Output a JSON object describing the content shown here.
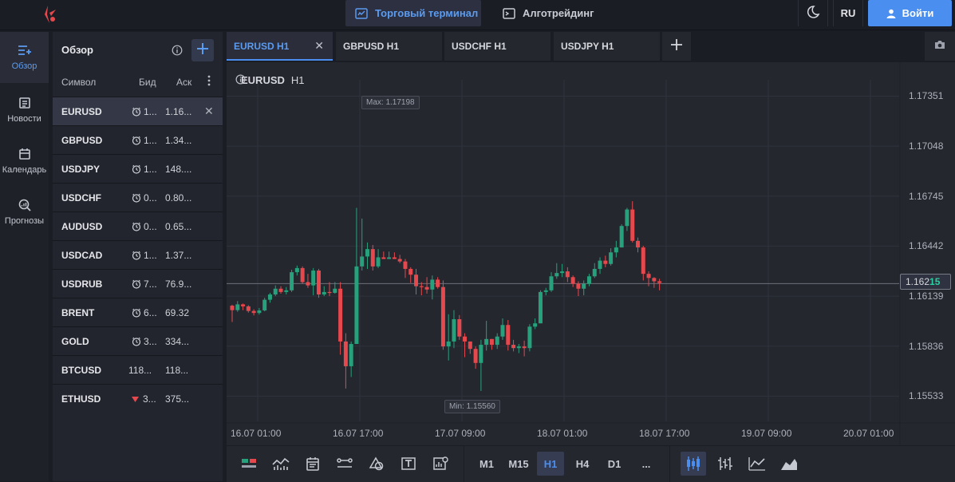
{
  "header": {
    "nav_terminal": "Торговый терминал",
    "nav_algo": "Алготрейдинг",
    "lang": "RU",
    "login": "Войти",
    "accent": "#4a8ef0"
  },
  "sidebar": {
    "items": [
      {
        "label": "Обзор",
        "icon": "watchlist-icon"
      },
      {
        "label": "Новости",
        "icon": "news-icon"
      },
      {
        "label": "Календарь",
        "icon": "calendar-icon"
      },
      {
        "label": "Прогнозы",
        "icon": "forecast-icon"
      }
    ]
  },
  "watchlist": {
    "title": "Обзор",
    "columns": {
      "symbol": "Символ",
      "bid": "Бид",
      "ask": "Аск"
    },
    "rows": [
      {
        "symbol": "EURUSD",
        "bid": "1...",
        "ask": "1.16...",
        "icon": "clock-icon"
      },
      {
        "symbol": "GBPUSD",
        "bid": "1...",
        "ask": "1.34...",
        "icon": "clock-icon"
      },
      {
        "symbol": "USDJPY",
        "bid": "1...",
        "ask": "148....",
        "icon": "clock-icon"
      },
      {
        "symbol": "USDCHF",
        "bid": "0...",
        "ask": "0.80...",
        "icon": "clock-icon"
      },
      {
        "symbol": "AUDUSD",
        "bid": "0...",
        "ask": "0.65...",
        "icon": "clock-icon"
      },
      {
        "symbol": "USDCAD",
        "bid": "1...",
        "ask": "1.37...",
        "icon": "clock-icon"
      },
      {
        "symbol": "USDRUB",
        "bid": "7...",
        "ask": "76.9...",
        "icon": "clock-icon"
      },
      {
        "symbol": "BRENT",
        "bid": "6...",
        "ask": "69.32",
        "icon": "clock-icon"
      },
      {
        "symbol": "GOLD",
        "bid": "3...",
        "ask": "334...",
        "icon": "clock-icon"
      },
      {
        "symbol": "BTCUSD",
        "bid": "118...",
        "ask": "118...",
        "icon": ""
      },
      {
        "symbol": "ETHUSD",
        "bid": "3...",
        "ask": "375...",
        "icon": "down-triangle-icon"
      }
    ]
  },
  "tabs": [
    {
      "label": "EURUSD H1"
    },
    {
      "label": "GBPUSD H1"
    },
    {
      "label": "USDCHF H1"
    },
    {
      "label": "USDJPY H1"
    }
  ],
  "chart": {
    "symbol": "EURUSD",
    "timeframe": "H1",
    "max_label": "Max: 1.17198",
    "min_label": "Min: 1.15560",
    "price_tag_main": "1.162",
    "price_tag_hl": "15",
    "up_color": "#26a17b",
    "down_color": "#e5484d"
  },
  "toolbar": {
    "timeframes": [
      "M1",
      "M15",
      "H1",
      "H4",
      "D1",
      "..."
    ],
    "active_timeframe": "H1"
  },
  "chart_data": {
    "type": "candlestick",
    "yticks": [
      "1.17351",
      "1.17048",
      "1.16745",
      "1.16442",
      "1.16139",
      "1.15836",
      "1.15533"
    ],
    "xticks": [
      "16.07 01:00",
      "16.07 17:00",
      "17.07 09:00",
      "18.07 01:00",
      "18.07 17:00",
      "19.07 09:00",
      "20.07 01:00"
    ],
    "current_price": 1.16215,
    "max": 1.17198,
    "min": 1.1556,
    "ylim": [
      1.1538,
      1.1745
    ],
    "candles": [
      [
        1.16081,
        1.16054,
        1.16087,
        1.15982
      ],
      [
        1.16054,
        1.16089,
        1.16109,
        1.16044
      ],
      [
        1.16089,
        1.16077,
        1.16094,
        1.16054
      ],
      [
        1.16077,
        1.16049,
        1.16084,
        1.16039
      ],
      [
        1.16049,
        1.16037,
        1.16059,
        1.16022
      ],
      [
        1.16037,
        1.16052,
        1.16067,
        1.16027
      ],
      [
        1.16052,
        1.16117,
        1.16129,
        1.16047
      ],
      [
        1.16117,
        1.16149,
        1.16159,
        1.16099
      ],
      [
        1.16149,
        1.16184,
        1.16204,
        1.16139
      ],
      [
        1.16184,
        1.16164,
        1.16199,
        1.16154
      ],
      [
        1.16164,
        1.16174,
        1.16194,
        1.16149
      ],
      [
        1.16174,
        1.16284,
        1.16299,
        1.16164
      ],
      [
        1.16284,
        1.16309,
        1.16324,
        1.16264
      ],
      [
        1.16309,
        1.16224,
        1.16319,
        1.16214
      ],
      [
        1.16224,
        1.16204,
        1.16274,
        1.16189
      ],
      [
        1.16204,
        1.16294,
        1.16309,
        1.16144
      ],
      [
        1.16294,
        1.16149,
        1.16304,
        1.16129
      ],
      [
        1.16149,
        1.16164,
        1.16199,
        1.16139
      ],
      [
        1.16164,
        1.16159,
        1.16224,
        1.16139
      ],
      [
        1.16159,
        1.16184,
        1.16224,
        1.16154
      ],
      [
        1.16184,
        1.15864,
        1.16224,
        1.15784
      ],
      [
        1.15864,
        1.15714,
        1.15914,
        1.15579
      ],
      [
        1.15714,
        1.15849,
        1.15864,
        1.15649
      ],
      [
        1.15849,
        1.16319,
        1.16674,
        1.15869
      ],
      [
        1.16319,
        1.16379,
        1.16609,
        1.16294
      ],
      [
        1.16379,
        1.16424,
        1.16464,
        1.16304
      ],
      [
        1.16424,
        1.16319,
        1.16449,
        1.16294
      ],
      [
        1.16319,
        1.16374,
        1.16424,
        1.16309
      ],
      [
        1.16374,
        1.16364,
        1.16409,
        1.16364
      ],
      [
        1.16364,
        1.16374,
        1.16409,
        1.16364
      ],
      [
        1.16374,
        1.16364,
        1.16404,
        1.16364
      ],
      [
        1.16364,
        1.16349,
        1.16389,
        1.16339
      ],
      [
        1.16349,
        1.16304,
        1.16364,
        1.16249
      ],
      [
        1.16304,
        1.16269,
        1.16314,
        1.16219
      ],
      [
        1.16269,
        1.16199,
        1.16304,
        1.16149
      ],
      [
        1.16199,
        1.16194,
        1.16224,
        1.16144
      ],
      [
        1.16194,
        1.16179,
        1.16254,
        1.16154
      ],
      [
        1.16179,
        1.16239,
        1.16264,
        1.16119
      ],
      [
        1.16239,
        1.16194,
        1.16254,
        1.16184
      ],
      [
        1.16194,
        1.15834,
        1.16234,
        1.15814
      ],
      [
        1.15834,
        1.15864,
        1.16029,
        1.15749
      ],
      [
        1.15864,
        1.15999,
        1.16054,
        1.15824
      ],
      [
        1.15999,
        1.15894,
        1.16024,
        1.15874
      ],
      [
        1.15894,
        1.15864,
        1.15914,
        1.15769
      ],
      [
        1.15864,
        1.15819,
        1.15864,
        1.15789
      ],
      [
        1.15819,
        1.15734,
        1.15834,
        1.15699
      ],
      [
        1.15734,
        1.15844,
        1.15874,
        1.15564
      ],
      [
        1.15844,
        1.15879,
        1.15989,
        1.15809
      ],
      [
        1.15879,
        1.15844,
        1.15879,
        1.15814
      ],
      [
        1.15844,
        1.15894,
        1.15914,
        1.15819
      ],
      [
        1.15894,
        1.15964,
        1.16004,
        1.15874
      ],
      [
        1.15964,
        1.15844,
        1.15994,
        1.15809
      ],
      [
        1.15844,
        1.15824,
        1.15874,
        1.15804
      ],
      [
        1.15824,
        1.15834,
        1.15849,
        1.15794
      ],
      [
        1.15834,
        1.15824,
        1.15869,
        1.15774
      ],
      [
        1.15824,
        1.15954,
        1.15969,
        1.15804
      ],
      [
        1.15954,
        1.15974,
        1.16004,
        1.15939
      ],
      [
        1.15974,
        1.16164,
        1.16174,
        1.15974
      ],
      [
        1.16164,
        1.16174,
        1.16189,
        1.16144
      ],
      [
        1.16174,
        1.16259,
        1.16284,
        1.16164
      ],
      [
        1.16259,
        1.16279,
        1.16339,
        1.16244
      ],
      [
        1.16279,
        1.16289,
        1.16334,
        1.16254
      ],
      [
        1.16289,
        1.16254,
        1.16314,
        1.16224
      ],
      [
        1.16254,
        1.16214,
        1.16264,
        1.16194
      ],
      [
        1.16214,
        1.16184,
        1.16229,
        1.16139
      ],
      [
        1.16184,
        1.16214,
        1.16234,
        1.16144
      ],
      [
        1.16214,
        1.16259,
        1.16274,
        1.16199
      ],
      [
        1.16259,
        1.16304,
        1.16339,
        1.16249
      ],
      [
        1.16304,
        1.16354,
        1.16374,
        1.16274
      ],
      [
        1.16354,
        1.16334,
        1.16384,
        1.16314
      ],
      [
        1.16334,
        1.16404,
        1.16429,
        1.16324
      ],
      [
        1.16404,
        1.16434,
        1.16474,
        1.16374
      ],
      [
        1.16434,
        1.16564,
        1.16574,
        1.16434
      ],
      [
        1.16564,
        1.16664,
        1.16674,
        1.16534
      ],
      [
        1.16664,
        1.16474,
        1.16714,
        1.16464
      ],
      [
        1.16474,
        1.16434,
        1.16494,
        1.16404
      ],
      [
        1.16434,
        1.16274,
        1.16444,
        1.16234
      ],
      [
        1.16274,
        1.16249,
        1.16289,
        1.16199
      ],
      [
        1.16249,
        1.16229,
        1.16254,
        1.16189
      ],
      [
        1.16229,
        1.16219,
        1.16244,
        1.16174
      ]
    ]
  }
}
